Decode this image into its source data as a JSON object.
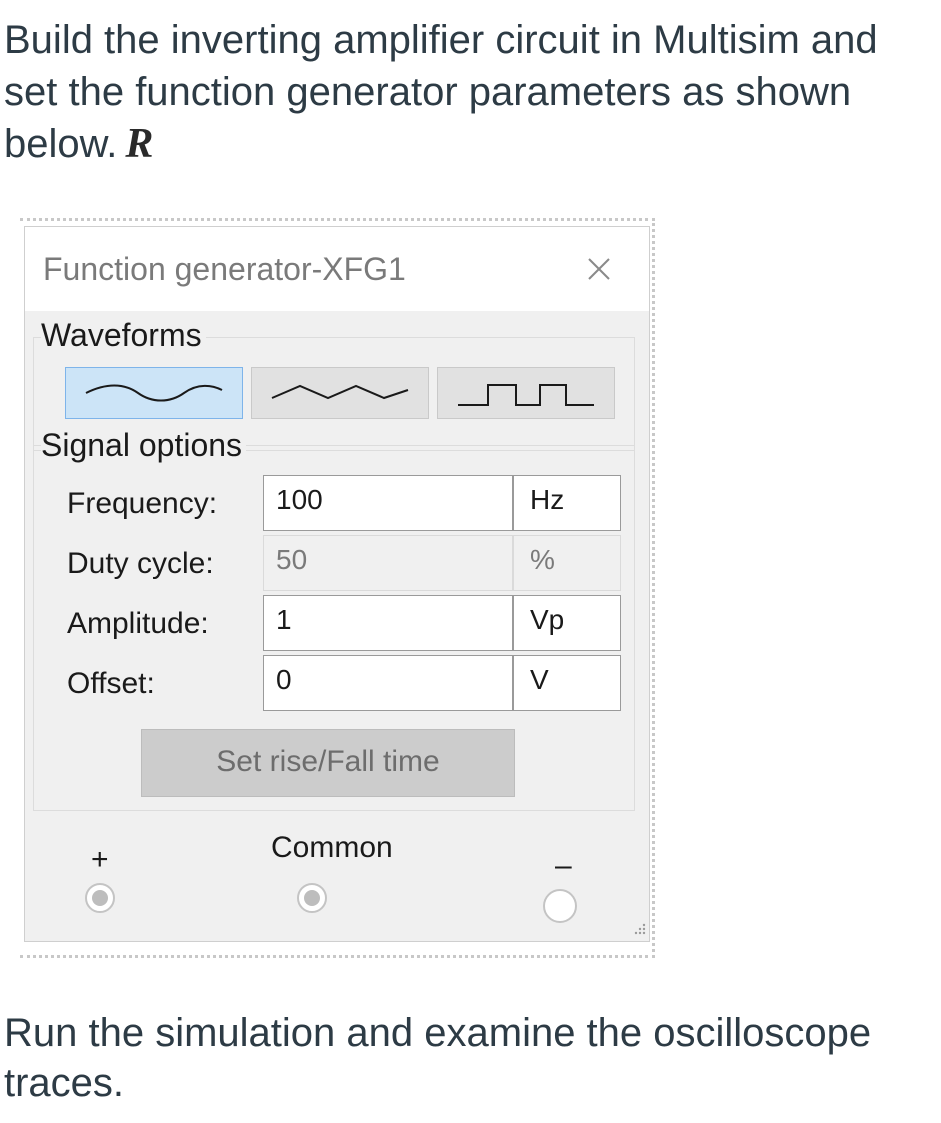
{
  "intro": {
    "text": "Build the inverting amplifier circuit in Multisim and set the function generator parameters as shown below.",
    "variable": "R"
  },
  "window": {
    "title": "Function generator-XFG1",
    "close_icon": "close-icon"
  },
  "waveforms": {
    "label": "Waveforms",
    "buttons": [
      {
        "icon": "sine-wave-icon",
        "selected": true
      },
      {
        "icon": "triangle-wave-icon",
        "selected": false
      },
      {
        "icon": "square-wave-icon",
        "selected": false
      }
    ]
  },
  "signal_options": {
    "label": "Signal options",
    "rows": [
      {
        "label": "Frequency:",
        "value": "100",
        "unit": "Hz",
        "enabled": true
      },
      {
        "label": "Duty cycle:",
        "value": "50",
        "unit": "%",
        "enabled": false
      },
      {
        "label": "Amplitude:",
        "value": "1",
        "unit": "Vp",
        "enabled": true
      },
      {
        "label": "Offset:",
        "value": "0",
        "unit": "V",
        "enabled": true
      }
    ],
    "rise_fall_button": "Set rise/Fall time"
  },
  "terminals": {
    "plus": "+",
    "common": "Common",
    "minus": "–"
  },
  "outro": {
    "text": "Run the simulation and examine the oscilloscope traces."
  },
  "colors": {
    "selected_bg": "#cce4f7",
    "selected_border": "#7eb4ea",
    "text": "#2d3b45"
  }
}
